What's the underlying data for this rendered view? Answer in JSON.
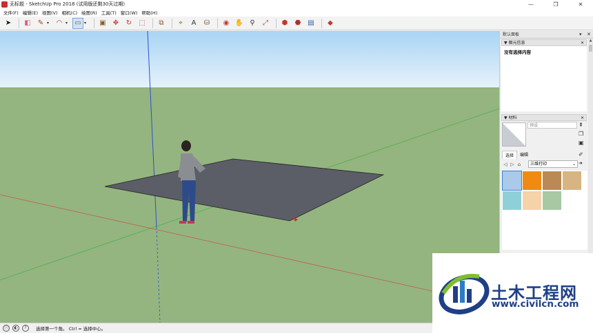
{
  "titlebar": {
    "title": "无标题 - SketchUp Pro 2018   (试用版还剩30天过期)",
    "controls": [
      "—",
      "❐",
      "✕"
    ]
  },
  "menu": [
    "文件(F)",
    "编辑(E)",
    "视图(V)",
    "相机(C)",
    "绘图(R)",
    "工具(T)",
    "窗口(W)",
    "帮助(H)"
  ],
  "toolbar": {
    "tools": [
      {
        "name": "select-tool",
        "glyph": "➤",
        "color": "#111"
      },
      {
        "name": "eraser-tool",
        "glyph": "◧",
        "color": "#d9607a"
      },
      {
        "name": "line-tool",
        "glyph": "✎",
        "color": "#b23a1a"
      },
      {
        "name": "arc-tool",
        "glyph": "◠",
        "color": "#c0392b"
      },
      {
        "name": "rectangle-tool",
        "glyph": "▭",
        "color": "#6b5a3a"
      },
      {
        "name": "pushpull-tool",
        "glyph": "▣",
        "color": "#8b5a2b"
      },
      {
        "name": "move-tool",
        "glyph": "✥",
        "color": "#c0392b"
      },
      {
        "name": "rotate-tool",
        "glyph": "↻",
        "color": "#c0392b"
      },
      {
        "name": "scale-tool",
        "glyph": "⬚",
        "color": "#c0392b"
      },
      {
        "name": "offset-tool",
        "glyph": "⧉",
        "color": "#8b5a2b"
      },
      {
        "name": "tape-measure-tool",
        "glyph": "⌖",
        "color": "#a06b1b"
      },
      {
        "name": "text-tool",
        "glyph": "A",
        "color": "#333"
      },
      {
        "name": "paint-bucket-tool",
        "glyph": "⛁",
        "color": "#6b4b2b"
      },
      {
        "name": "orbit-tool",
        "glyph": "◉",
        "color": "#c0392b"
      },
      {
        "name": "pan-tool",
        "glyph": "✋",
        "color": "#b08040"
      },
      {
        "name": "zoom-tool",
        "glyph": "⚲",
        "color": "#333"
      },
      {
        "name": "zoom-extents-tool",
        "glyph": "⤢",
        "color": "#c0392b"
      },
      {
        "name": "warehouse-tool",
        "glyph": "⬢",
        "color": "#c0392b"
      },
      {
        "name": "extension-warehouse-tool",
        "glyph": "⬣",
        "color": "#b0302a"
      },
      {
        "name": "send-to-layout-tool",
        "glyph": "▤",
        "color": "#2a5fb0"
      },
      {
        "name": "ruby-tool",
        "glyph": "◆",
        "color": "#c0392b"
      }
    ]
  },
  "tray": {
    "title": "默认面板",
    "controls": [
      "▾",
      "✕"
    ],
    "entity_info": {
      "heading": "图元信息",
      "text": "没有选择内容"
    },
    "materials": {
      "heading": "材料",
      "name_placeholder": "预设",
      "tabs": [
        "选择",
        "编辑"
      ],
      "library": "三维打印",
      "swatches": [
        "#a9cbe9",
        "#f08a12",
        "#b98a55",
        "#d6b582",
        "#8ed0d8",
        "#f6d2a8",
        "#a6c9a4"
      ],
      "selected_swatch": 0
    },
    "scroll_up": "▲"
  },
  "status": {
    "icons": [
      "ⓘ",
      "◐",
      "?"
    ],
    "text": "选择第一个角。  Ctrl = 选择中心。"
  },
  "watermark": {
    "title": "土木工程网",
    "url": "www.civilcn.com"
  }
}
